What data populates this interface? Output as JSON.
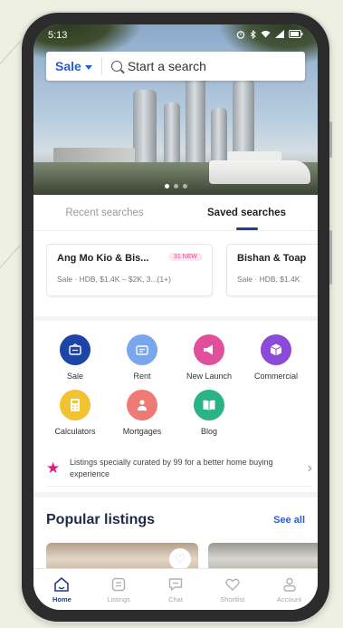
{
  "status_bar": {
    "time": "5:13"
  },
  "search": {
    "type_label": "Sale",
    "placeholder": "Start a search"
  },
  "hero": {
    "slide_count": 3,
    "active_slide": 1
  },
  "tabs": [
    {
      "label": "Recent searches",
      "active": false
    },
    {
      "label": "Saved searches",
      "active": true
    }
  ],
  "saved_searches": [
    {
      "title": "Ang Mo Kio & Bis...",
      "badge": "31 NEW",
      "subtitle": "Sale · HDB, $1.4K – $2K, 3...(1+)"
    },
    {
      "title": "Bishan & Toap",
      "subtitle": "Sale · HDB, $1.4K"
    }
  ],
  "quick_actions": [
    {
      "label": "Sale",
      "color": "#1d45a8",
      "icon": "sale-icon"
    },
    {
      "label": "Rent",
      "color": "#7aa6ee",
      "icon": "rent-icon"
    },
    {
      "label": "New Launch",
      "color": "#e14f9c",
      "icon": "megaphone-icon"
    },
    {
      "label": "Commercial",
      "color": "#8b4ad8",
      "icon": "cube-icon"
    },
    {
      "label": "Calculators",
      "color": "#f2c230",
      "icon": "calculator-icon"
    },
    {
      "label": "Mortgages",
      "color": "#ee7a76",
      "icon": "mortgage-icon"
    },
    {
      "label": "Blog",
      "color": "#2ab384",
      "icon": "book-icon"
    }
  ],
  "curated": {
    "text": "Listings specially curated by 99 for a better home buying experience"
  },
  "popular": {
    "title": "Popular listings",
    "see_all": "See all"
  },
  "bottom_nav": [
    {
      "label": "Home",
      "active": true,
      "icon": "home-icon"
    },
    {
      "label": "Listings",
      "active": false,
      "icon": "listings-icon"
    },
    {
      "label": "Chat",
      "active": false,
      "icon": "chat-icon"
    },
    {
      "label": "Shortlist",
      "active": false,
      "icon": "heart-icon"
    },
    {
      "label": "Account",
      "active": false,
      "icon": "account-icon"
    }
  ]
}
